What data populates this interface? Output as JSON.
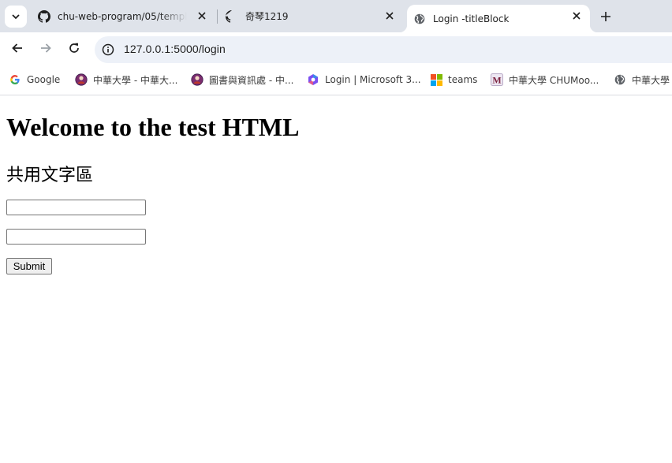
{
  "tabs": [
    {
      "title": "chu-web-program/05/templa",
      "icon": "github-icon",
      "active": false
    },
    {
      "title": "奇琴1219",
      "icon": "github-icon",
      "active": false
    },
    {
      "title": "Login -titleBlock",
      "icon": "globe-icon",
      "active": true
    }
  ],
  "address_bar": {
    "url": "127.0.0.1:5000/login"
  },
  "bookmarks": [
    {
      "label": "Google",
      "icon": "google-icon"
    },
    {
      "label": "中華大學 - 中華大...",
      "icon": "chu-logo-icon"
    },
    {
      "label": "圖書與資訊處 - 中...",
      "icon": "chu-logo-icon"
    },
    {
      "label": "Login | Microsoft 3...",
      "icon": "microsoft-365-icon"
    },
    {
      "label": "teams",
      "icon": "microsoft-logo-icon"
    },
    {
      "label": "中華大學 CHUMoo...",
      "icon": "moodle-icon"
    },
    {
      "label": "中華大學",
      "icon": "globe-icon"
    }
  ],
  "page": {
    "heading": "Welcome to the test HTML",
    "subheading": "共用文字區",
    "input1_value": "",
    "input2_value": "",
    "submit_label": "Submit"
  },
  "colors": {
    "tabstrip_bg": "#dfe3ea",
    "omnibox_bg": "#edf1f8",
    "page_bg": "#ffffff"
  }
}
